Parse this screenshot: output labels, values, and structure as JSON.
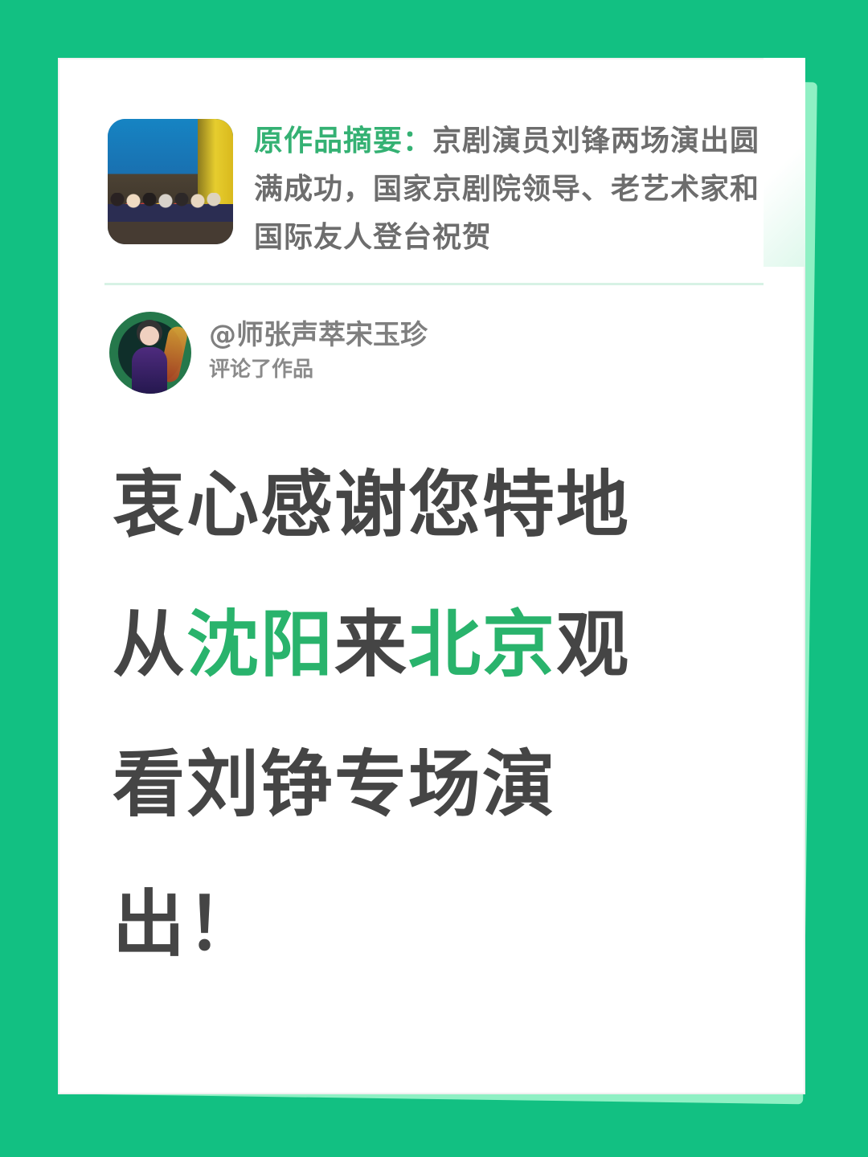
{
  "summary": {
    "label": "原作品摘要：",
    "text": "京剧演员刘锋两场演出圆满成功，国家京剧院领导、老艺术家和国际友人登台祝贺"
  },
  "commenter": {
    "name": "@师张声萃宋玉珍",
    "action": "评论了作品"
  },
  "message": {
    "line1": "衷心感谢您特地",
    "line2_prefix": "从",
    "line2_h1": "沈阳",
    "line2_mid": "来",
    "line2_h2": "北京",
    "line2_suffix": "观",
    "line3": "看刘铮专场演",
    "line4": "出！"
  },
  "colors": {
    "background": "#12c082",
    "accent": "#29b36c",
    "text": "#454545"
  },
  "icons": {
    "thumbnail": "performance-thumbnail",
    "avatar": "user-avatar"
  }
}
